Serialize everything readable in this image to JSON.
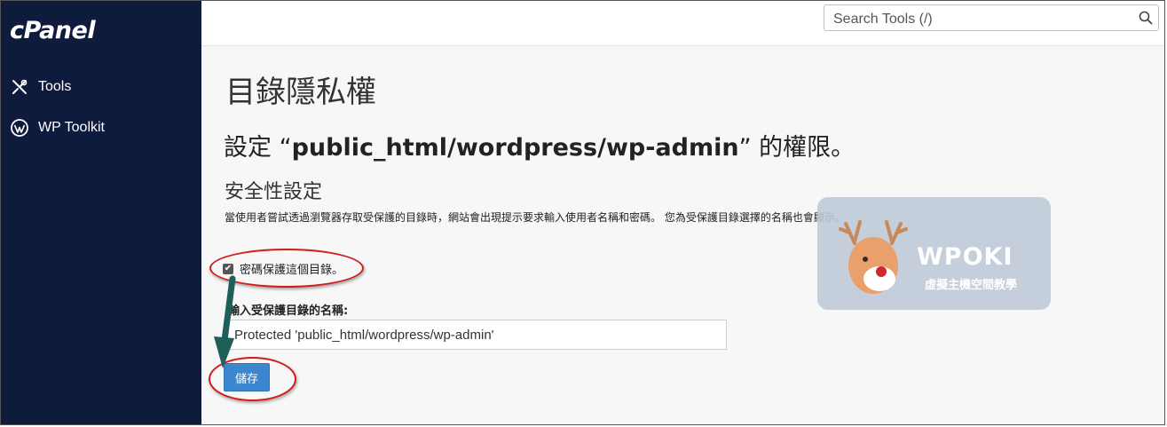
{
  "sidebar": {
    "logo": "cPanel",
    "items": [
      {
        "label": "Tools",
        "icon": "tools-icon"
      },
      {
        "label": "WP Toolkit",
        "icon": "wordpress-icon"
      }
    ]
  },
  "search": {
    "placeholder": "Search Tools (/)"
  },
  "page": {
    "title": "目錄隱私權",
    "subtitle_prefix": "設定 “",
    "subtitle_path": "public_html/wordpress/wp-admin",
    "subtitle_suffix": "” 的權限。",
    "section_title": "安全性設定",
    "description": "當使用者嘗試透過瀏覽器存取受保護的目錄時，網站會出現提示要求輸入使用者名稱和密碼。 您為受保護目錄選擇的名稱也會顯示。",
    "checkbox_label": "密碼保護這個目錄。",
    "checkbox_checked": true,
    "name_label": "輸入受保護目錄的名稱:",
    "name_value": "Protected 'public_html/wordpress/wp-admin'",
    "save_label": "儲存"
  },
  "watermark": {
    "brand": "WPOKI",
    "tagline": "虛擬主機空間教學"
  },
  "colors": {
    "sidebar": "#0f1b3d",
    "button": "#3c86cf",
    "highlight": "#d01c1c",
    "arrow": "#1f5f5a"
  }
}
